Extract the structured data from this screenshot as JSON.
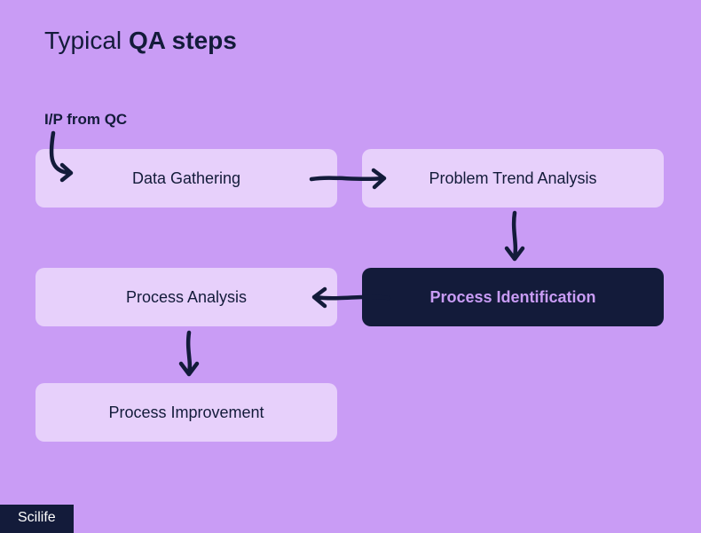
{
  "title": {
    "light": "Typical ",
    "bold": "QA steps"
  },
  "input_label": "I/P from QC",
  "boxes": {
    "data_gathering": "Data Gathering",
    "problem_trend": "Problem Trend Analysis",
    "process_identification": "Process Identification",
    "process_analysis": "Process Analysis",
    "process_improvement": "Process Improvement"
  },
  "footer": "Scilife",
  "flow": [
    "I/P from QC",
    "Data Gathering",
    "Problem Trend Analysis",
    "Process Identification",
    "Process Analysis",
    "Process Improvement"
  ],
  "colors": {
    "background": "#c99cf5",
    "box_light": "#e7d0fb",
    "box_dark": "#131b3a",
    "text_dark": "#131b3a",
    "text_on_dark": "#c99cf5"
  }
}
